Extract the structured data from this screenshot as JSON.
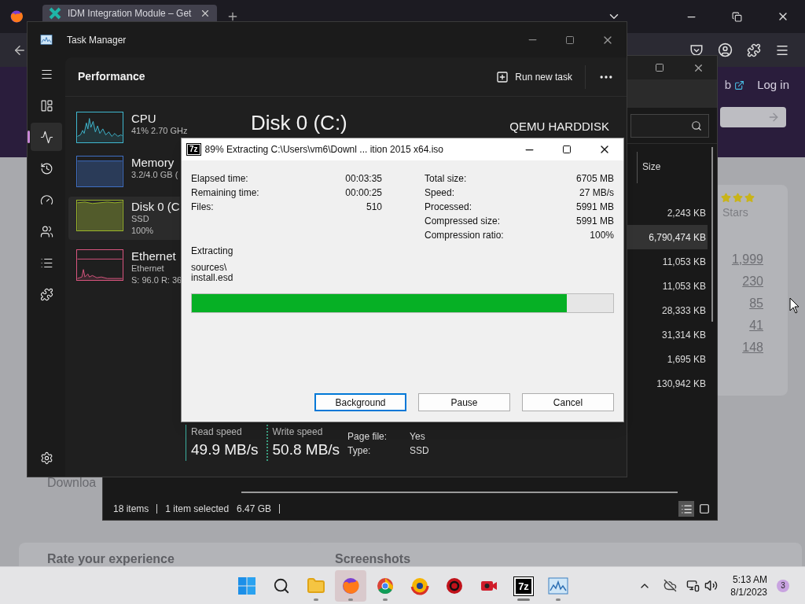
{
  "browser": {
    "tab_title": "IDM Integration Module – Get",
    "header_link": "b",
    "login": "Log in",
    "stars": 3,
    "stars_label": "Stars",
    "counts": [
      "1,999",
      "230",
      "85",
      "41",
      "148"
    ],
    "card_text": "Downloa",
    "sections": [
      "Rate your experience",
      "Screenshots"
    ]
  },
  "explorer": {
    "column": "Size",
    "sizes": [
      {
        "text": "2,243 KB",
        "selected": false
      },
      {
        "text": "6,790,474 KB",
        "selected": true
      },
      {
        "text": "11,053 KB",
        "selected": false
      },
      {
        "text": "11,053 KB",
        "selected": false
      },
      {
        "text": "28,333 KB",
        "selected": false
      },
      {
        "text": "31,314 KB",
        "selected": false
      },
      {
        "text": "1,695 KB",
        "selected": false
      },
      {
        "text": "130,942 KB",
        "selected": false
      }
    ],
    "status": [
      "18 items",
      "1 item selected",
      "6.47 GB"
    ],
    "view_buttons": [
      {
        "kind": "details",
        "selected": true
      },
      {
        "kind": "tiles",
        "selected": false
      }
    ]
  },
  "task_manager": {
    "title": "Task Manager",
    "page": "Performance",
    "run_task": "Run new task",
    "nav": [
      {
        "kind": "menu",
        "selected": false
      },
      {
        "kind": "processes",
        "selected": false
      },
      {
        "kind": "performance",
        "selected": true
      },
      {
        "kind": "history",
        "selected": false
      },
      {
        "kind": "startup",
        "selected": false
      },
      {
        "kind": "users",
        "selected": false
      },
      {
        "kind": "details",
        "selected": false
      },
      {
        "kind": "services",
        "selected": false
      },
      {
        "kind": "settings",
        "selected": false
      }
    ],
    "resources": [
      {
        "name": "CPU",
        "lines": [
          "41% 2.70 GHz"
        ],
        "color": "#3fb8d0",
        "kind": "spiky",
        "selected": false
      },
      {
        "name": "Memory",
        "lines": [
          "3.2/4.0 GB ("
        ],
        "color": "#3f6fc4",
        "kind": "flat",
        "selected": false
      },
      {
        "name": "Disk 0 (C",
        "lines": [
          "SSD",
          "100%"
        ],
        "color": "#9ab52a",
        "kind": "full",
        "selected": true
      },
      {
        "name": "Ethernet",
        "lines": [
          "Ethernet",
          "S: 96.0 R: 36"
        ],
        "color": "#d9557f",
        "kind": "low",
        "selected": false
      }
    ],
    "heading": "Disk 0 (C:)",
    "model": "QEMU HARDDISK",
    "speeds": [
      {
        "label": "Read speed",
        "value": "49.9 MB/s",
        "kind": "solid"
      },
      {
        "label": "Write speed",
        "value": "50.8 MB/s",
        "kind": "dotted"
      }
    ],
    "properties": [
      {
        "label": "Page file:",
        "value": "Yes"
      },
      {
        "label": "Type:",
        "value": "SSD"
      }
    ]
  },
  "dialog": {
    "icon_text": "7z",
    "title": "89% Extracting C:\\Users\\vm6\\Downl ... ition 2015 x64.iso",
    "left_stats": [
      {
        "label": "Elapsed time:",
        "value": "00:03:35"
      },
      {
        "label": "Remaining time:",
        "value": "00:00:25"
      },
      {
        "label": "Files:",
        "value": "510"
      }
    ],
    "right_stats": [
      {
        "label": "Total size:",
        "value": "6705 MB"
      },
      {
        "label": "Speed:",
        "value": "27 MB/s"
      },
      {
        "label": "Processed:",
        "value": "5991 MB"
      },
      {
        "label": "Compressed size:",
        "value": "5991 MB"
      },
      {
        "label": "Compression ratio:",
        "value": "100%"
      }
    ],
    "status": "Extracting",
    "path": [
      "sources\\",
      "install.esd"
    ],
    "progress": {
      "level": 0.89
    },
    "buttons": [
      {
        "label": "Background",
        "selected": true
      },
      {
        "label": "Pause",
        "selected": false
      },
      {
        "label": "Cancel",
        "selected": false
      }
    ]
  },
  "taskbar": {
    "apps": [
      {
        "kind": "start",
        "running": false,
        "selected": false
      },
      {
        "kind": "search",
        "running": false,
        "selected": false
      },
      {
        "kind": "folder",
        "running": true,
        "selected": false
      },
      {
        "kind": "firefox",
        "running": true,
        "selected": true
      },
      {
        "kind": "chrome",
        "running": true,
        "selected": false
      },
      {
        "kind": "browser",
        "running": false,
        "selected": false
      },
      {
        "kind": "gear",
        "running": false,
        "selected": false
      },
      {
        "kind": "camera",
        "running": false,
        "selected": false
      },
      {
        "kind": "sevenzip",
        "label": "7z",
        "running": true,
        "selected": false
      },
      {
        "kind": "monitor",
        "running": true,
        "selected": false
      }
    ],
    "time": "5:13 AM",
    "date": "8/1/2023",
    "badge": "3"
  }
}
